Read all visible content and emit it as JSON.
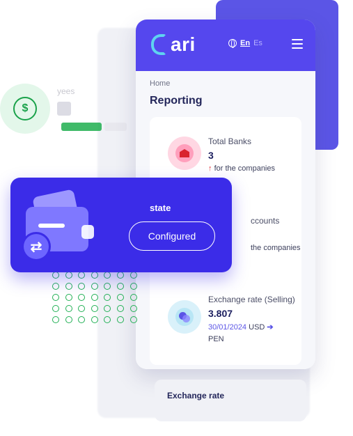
{
  "header": {
    "logo_text": "ari",
    "lang_active": "En",
    "lang_other": "Es"
  },
  "breadcrumb": "Home",
  "page_title": "Reporting",
  "items": [
    {
      "label": "Total Banks",
      "value": "3",
      "sub": "for the companies"
    },
    {
      "label": "ccounts",
      "sub": "the companies"
    },
    {
      "label": "Exchange rate (Selling)",
      "value": "3.807",
      "date": "30/01/2024",
      "from": "USD",
      "to": "PEN"
    }
  ],
  "bottom_card": "Exchange rate",
  "employees_text": "yees",
  "state_card": {
    "label": "state",
    "button": "Configured"
  },
  "colors": {
    "primary": "#5547ee",
    "state_card": "#3b2ce8",
    "green": "#1aa24a",
    "up_arrow": "#e4353a"
  }
}
